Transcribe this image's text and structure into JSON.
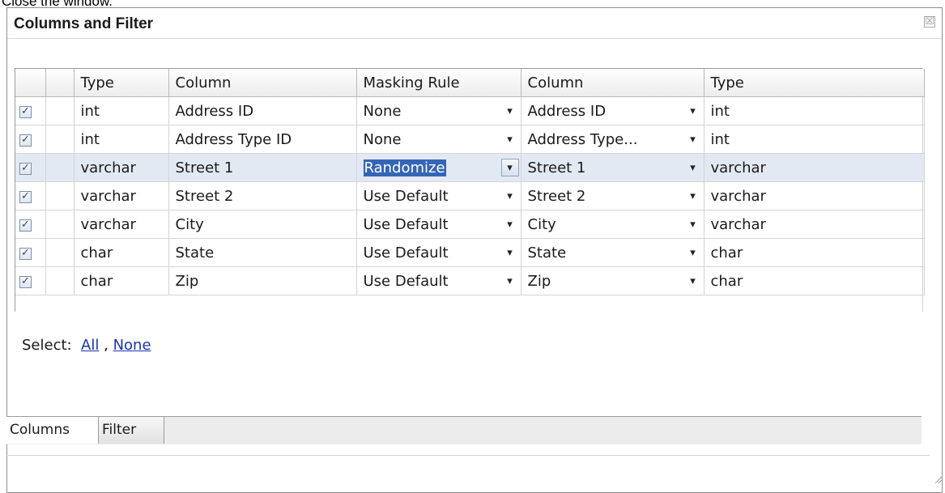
{
  "instruction": "Close the window.",
  "window": {
    "title": "Columns and Filter",
    "close_glyph": "☒"
  },
  "grid": {
    "headers": [
      "",
      "",
      "Type",
      "Column",
      "Masking Rule",
      "Column",
      "Type"
    ],
    "rows": [
      {
        "checked": true,
        "src_type": "int",
        "src_column": "Address ID",
        "rule": "None",
        "dst_column": "Address ID",
        "dst_type": "int"
      },
      {
        "checked": true,
        "src_type": "int",
        "src_column": "Address Type ID",
        "rule": "None",
        "dst_column": "Address Type...",
        "dst_type": "int"
      },
      {
        "checked": true,
        "src_type": "varchar",
        "src_column": "Street 1",
        "rule": "Randomize",
        "dst_column": "Street 1",
        "dst_type": "varchar"
      },
      {
        "checked": true,
        "src_type": "varchar",
        "src_column": "Street 2",
        "rule": "Use Default",
        "dst_column": "Street 2",
        "dst_type": "varchar"
      },
      {
        "checked": true,
        "src_type": "varchar",
        "src_column": "City",
        "rule": "Use Default",
        "dst_column": "City",
        "dst_type": "varchar"
      },
      {
        "checked": true,
        "src_type": "char",
        "src_column": "State",
        "rule": "Use Default",
        "dst_column": "State",
        "dst_type": "char"
      },
      {
        "checked": true,
        "src_type": "char",
        "src_column": "Zip",
        "rule": "Use Default",
        "dst_column": "Zip",
        "dst_type": "char"
      }
    ],
    "selected_row": 2
  },
  "select": {
    "label": "Select:",
    "all": "All",
    "separator": ",",
    "none": "None"
  },
  "tabs": {
    "columns": "Columns",
    "filter": "Filter"
  },
  "colors": {
    "selection": "#3465b6",
    "selected_row": "#e3e9f3",
    "link": "#1933b0"
  }
}
